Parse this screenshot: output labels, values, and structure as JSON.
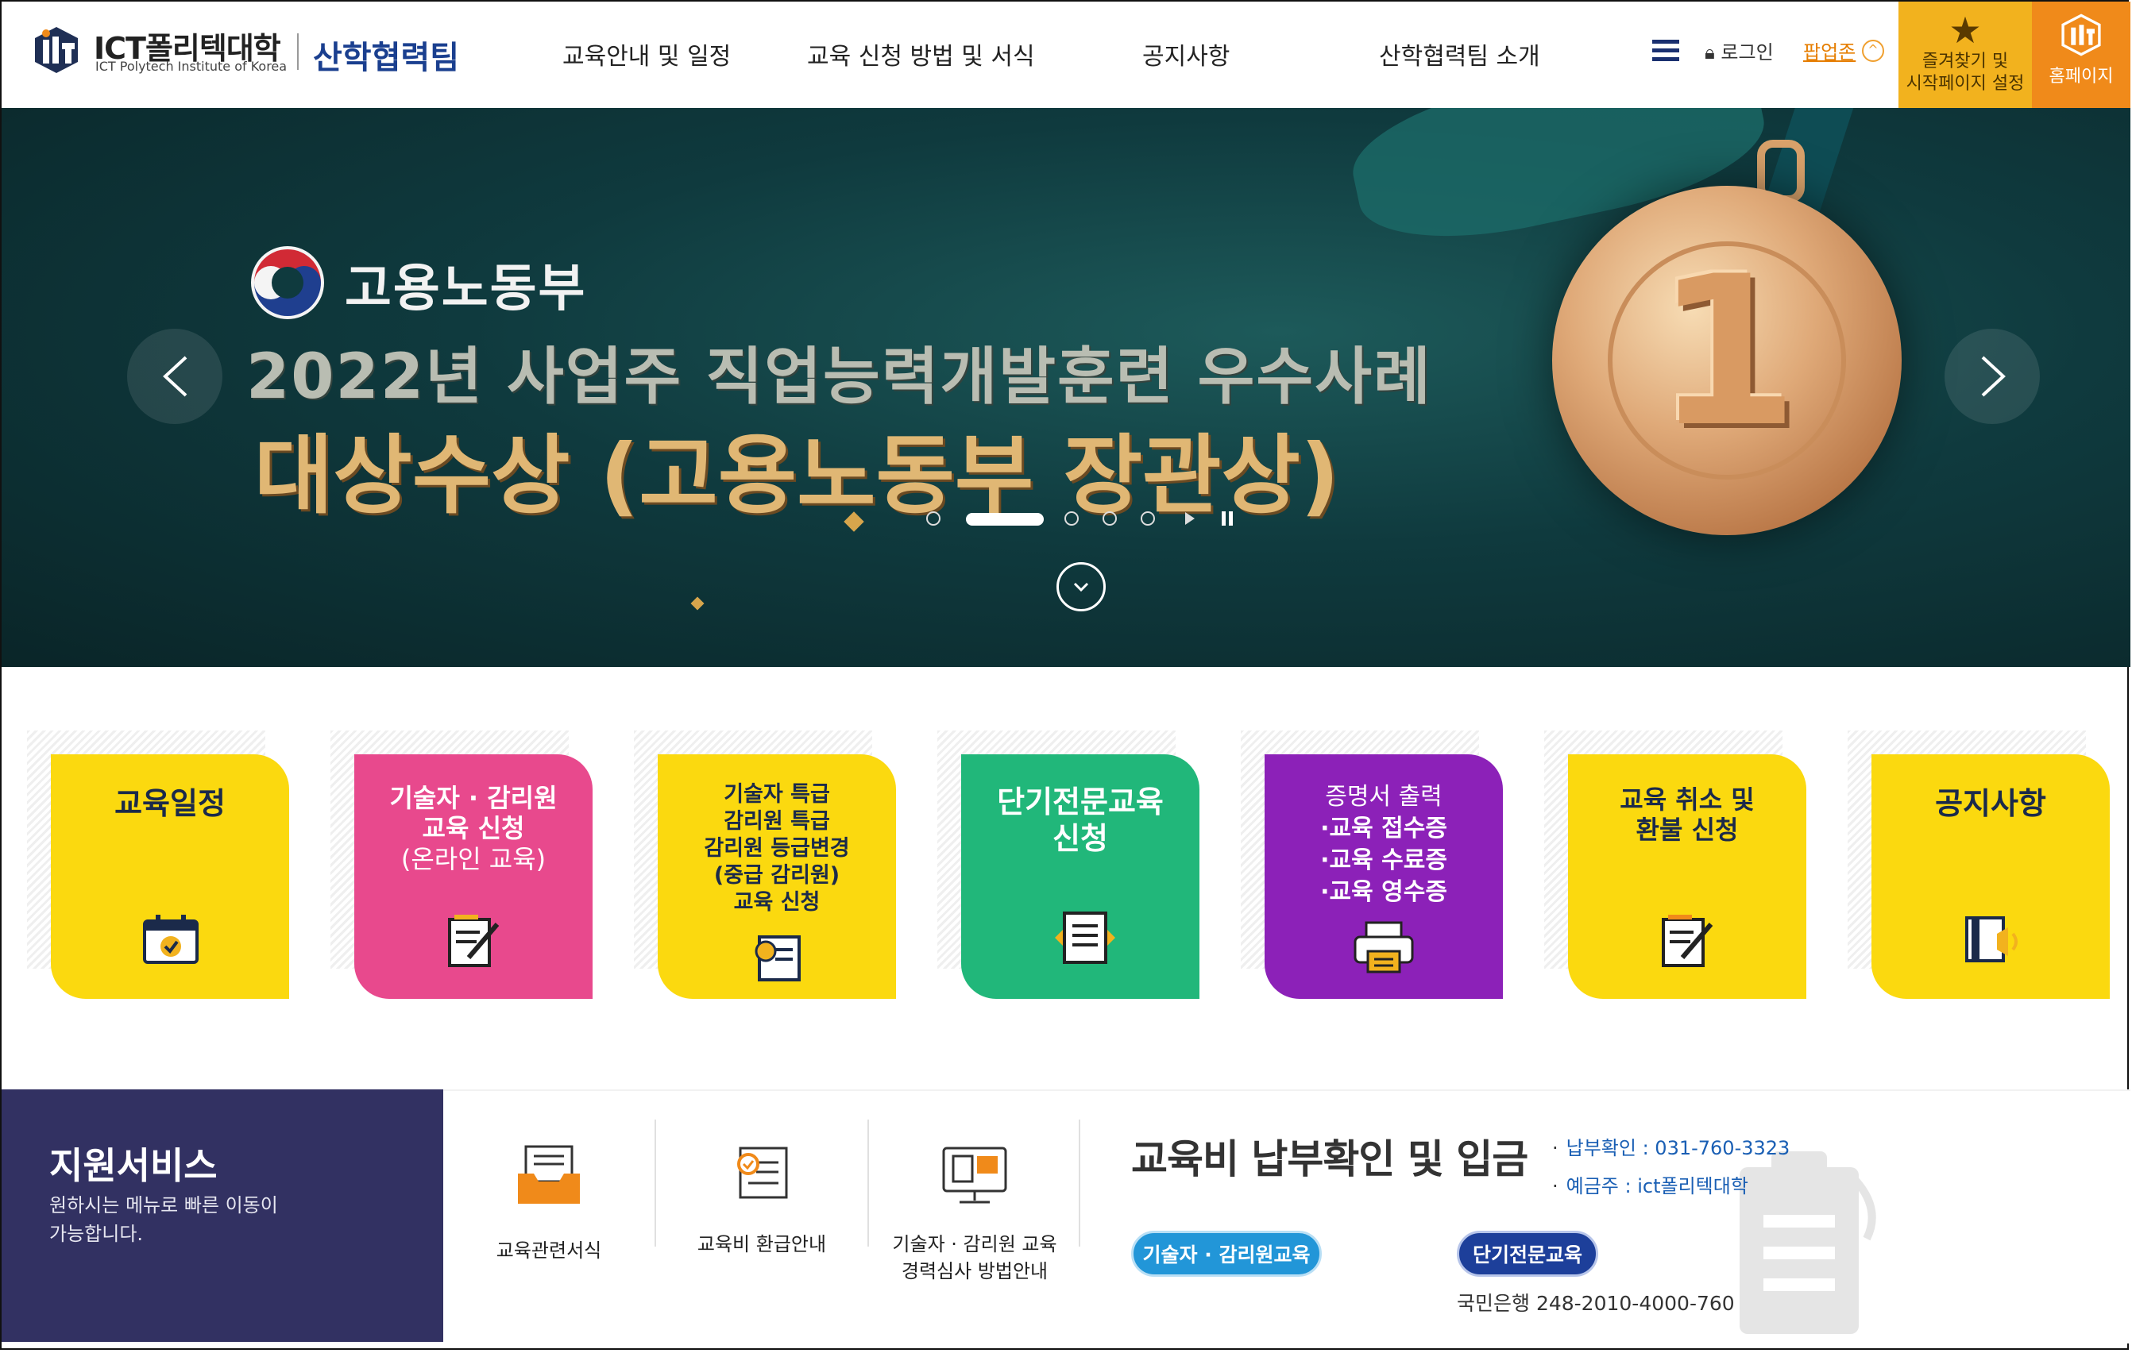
{
  "header": {
    "logo_ko": "ICT폴리텍대학",
    "logo_en": "ICT Polytech Institute of Korea",
    "team_name": "산학협력팀",
    "nav": [
      "교육안내 및 일정",
      "교육 신청 방법 및 서식",
      "공지사항",
      "산학협력팀 소개"
    ],
    "login": "로그인",
    "popup_zone": "팝업존",
    "favorites_line1": "즐겨찾기 및",
    "favorites_line2": "시작페이지 설정",
    "home_label": "홈페이지"
  },
  "banner": {
    "ministry": "고용노동부",
    "headline": "2022년 사업주 직업능력개발훈련 우수사례",
    "subheadline": "대상수상 (고용노동부 장관상)",
    "medal_number": "1",
    "slide_count": 5,
    "active_slide": 2
  },
  "quick_tiles": [
    {
      "lines": [
        "교육일정"
      ],
      "color": "yellow",
      "icon": "calendar-icon"
    },
    {
      "lines": [
        "기술자 · 감리원",
        "교육 신청",
        "(온라인 교육)"
      ],
      "color": "pink",
      "icon": "edit-document-icon"
    },
    {
      "lines": [
        "기술자 특급",
        "감리원 특급",
        "감리원 등급변경",
        "(중급 감리원)",
        "교육 신청"
      ],
      "color": "yellow",
      "icon": "scroll-icon"
    },
    {
      "lines": [
        "단기전문교육",
        "신청"
      ],
      "color": "green",
      "icon": "document-icon"
    },
    {
      "lines": [
        "증명서 출력",
        "·교육 접수증",
        "·교육 수료증",
        "·교육 영수증"
      ],
      "color": "purple",
      "icon": "printer-icon"
    },
    {
      "lines": [
        "교육 취소 및",
        "환불 신청"
      ],
      "color": "yellow",
      "icon": "cancel-form-icon"
    },
    {
      "lines": [
        "공지사항"
      ],
      "color": "yellow",
      "icon": "notice-speaker-icon"
    }
  ],
  "support": {
    "title": "지원서비스",
    "desc": "원하시는 메뉴로 빠른 이동이 가능합니다.",
    "services": [
      {
        "label": "교육관련서식",
        "icon": "inbox-tray-icon"
      },
      {
        "label": "교육비 환급안내",
        "icon": "refund-scroll-icon"
      },
      {
        "label": "기술자 · 감리원 교육\n경력심사 방법안내",
        "icon": "monitor-icon"
      }
    ]
  },
  "payment": {
    "title": "교육비 납부확인 및 입금",
    "phone": "납부확인 : 031-760-3323",
    "holder": "예금주 : ict폴리텍대학",
    "button1": "기술자 · 감리원교육",
    "button2": "단기전문교육",
    "bank_account": "국민은행 248-2010-4000-760"
  },
  "colors": {
    "navy": "#1a3f8f",
    "orange": "#f08a1a",
    "gold": "#f2b21e",
    "yellow": "#fbd90f",
    "pink": "#e8498d",
    "green": "#21b77a",
    "purple": "#8c21b8",
    "support_bg": "#323162"
  }
}
